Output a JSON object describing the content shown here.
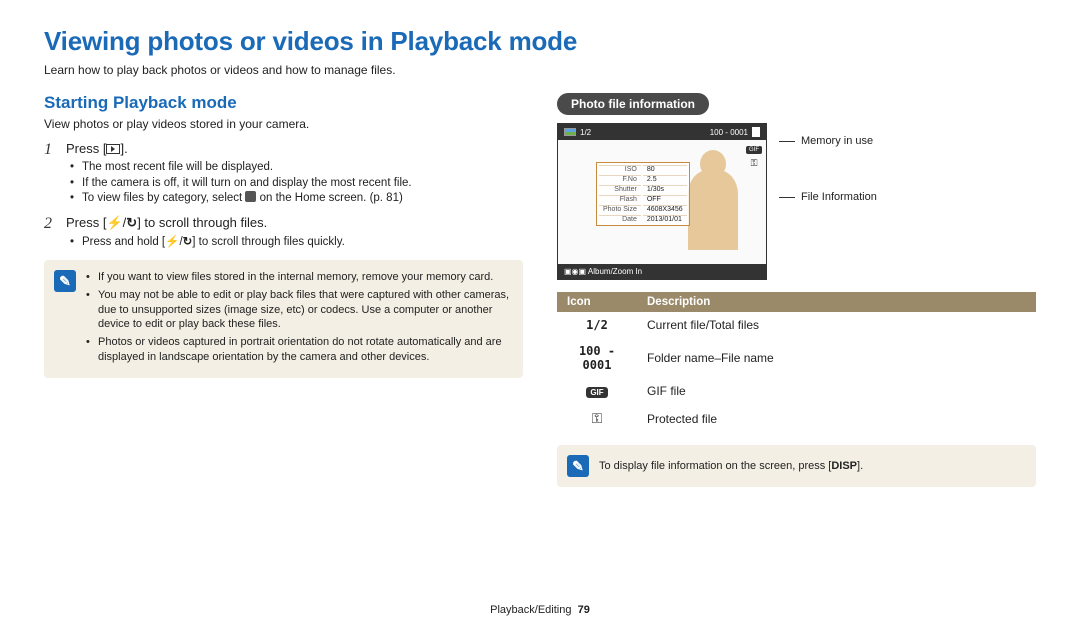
{
  "title": "Viewing photos or videos in Playback mode",
  "intro": "Learn how to play back photos or videos and how to manage files.",
  "left": {
    "heading": "Starting Playback mode",
    "sub": "View photos or play videos stored in your camera.",
    "step1_label": "Press [",
    "step1_tail": "].",
    "step1_bullets": [
      "The most recent file will be displayed.",
      "If the camera is off, it will turn on and display the most recent file.",
      "To view files by category, select       on the Home screen. p. 81"
    ],
    "step2_label": "Press [",
    "step2_mid": "/",
    "step2_tail": "] to scroll through files.",
    "step2_bullets": [
      "Press and hold [  /  ] to scroll through files quickly."
    ],
    "note_bullets": [
      "If you want to view files stored in the internal memory, remove your memory card.",
      "You may not be able to edit or play back files that were captured with other cameras, due to unsupported sizes (image size, etc) or codecs. Use a computer or another device to edit or play back these files.",
      "Photos or videos captured in portrait orientation do not rotate automatically and are displayed in landscape orientation by the camera and other devices."
    ]
  },
  "right": {
    "pill": "Photo file information",
    "topbar_counter": "1/2",
    "topbar_file": "100 - 0001",
    "info_rows": [
      [
        "ISO",
        "80"
      ],
      [
        "F.No",
        "2.5"
      ],
      [
        "Shutter",
        "1/30s"
      ],
      [
        "Flash",
        "OFF"
      ],
      [
        "Photo Size",
        "4608X3456"
      ],
      [
        "Date",
        "2013/01/01"
      ]
    ],
    "bottom_bar": "Album/Zoom In",
    "annot1": "Memory in use",
    "annot2": "File Information",
    "table_head_icon": "Icon",
    "table_head_desc": "Description",
    "rows": [
      {
        "icon": "1/2",
        "desc": "Current file/Total files"
      },
      {
        "icon": "100 - 0001",
        "desc": "Folder name–File name"
      },
      {
        "icon": "GIF",
        "desc": "GIF file"
      },
      {
        "icon": "key",
        "desc": "Protected file"
      }
    ],
    "tip": "To display file information on the screen, press [",
    "tip_btn": "DISP",
    "tip_tail": "]."
  },
  "footer_section": "Playback/Editing",
  "footer_page": "79"
}
